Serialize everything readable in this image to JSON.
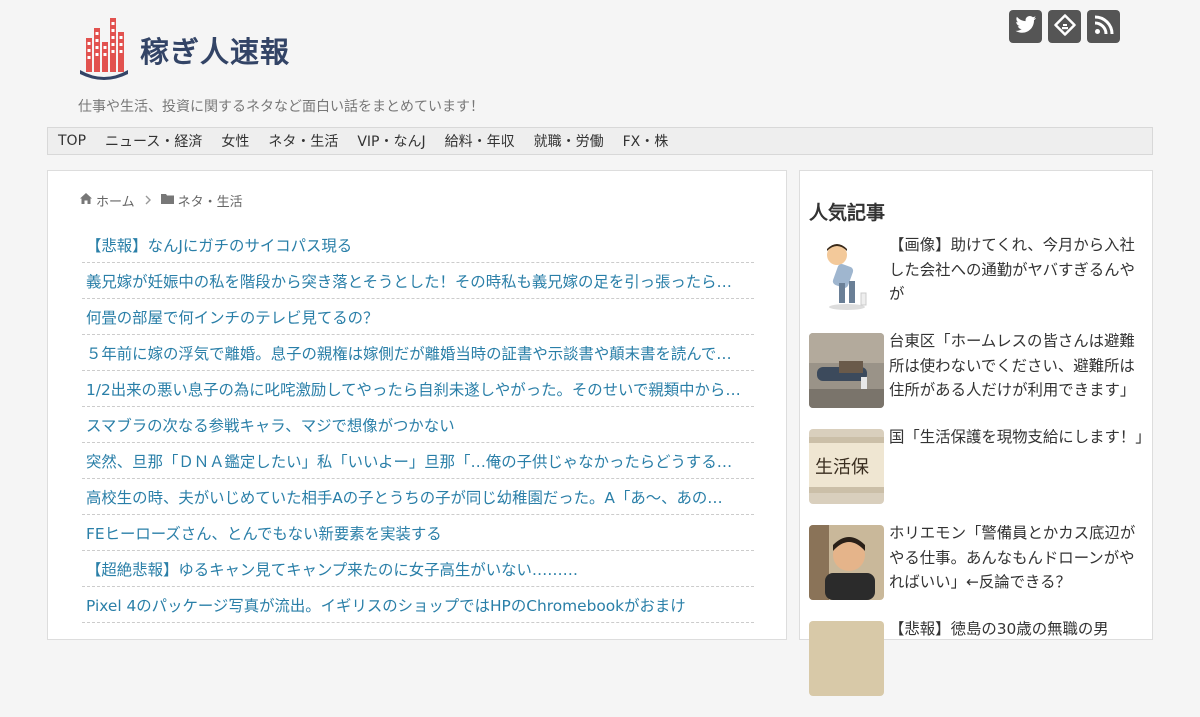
{
  "site": {
    "logo_text": "稼ぎ人速報",
    "tagline": "仕事や生活、投資に関するネタなど面白い話をまとめています！"
  },
  "social": [
    {
      "icon": "twitter-icon"
    },
    {
      "icon": "feedly-icon"
    },
    {
      "icon": "rss-icon"
    }
  ],
  "nav": {
    "items": [
      "TOP",
      "ニュース・経済",
      "女性",
      "ネタ・生活",
      "VIP・なんJ",
      "給料・年収",
      "就職・労働",
      "FX・株"
    ]
  },
  "breadcrumb": {
    "home": "ホーム",
    "category": "ネタ・生活"
  },
  "articles": [
    "【悲報】なんJにガチのサイコパス現る",
    "義兄嫁が妊娠中の私を階段から突き落とそうとした！その時私も義兄嫁の足を引っ張ったら…",
    "何畳の部屋で何インチのテレビ見てるの？",
    "５年前に嫁の浮気で離婚。息子の親権は嫁側だが離婚当時の証書や示談書や顛末書を読んで…",
    "1/2出来の悪い息子の為に叱咤激励してやったら自刹未遂しやがった。そのせいで親類中から…",
    "スマブラの次なる参戦キャラ、マジで想像がつかない",
    "突然、旦那「ＤＮＡ鑑定したい」私「いいよー」旦那「…俺の子供じゃなかったらどうする…",
    "高校生の時、夫がいじめていた相手Aの子とうちの子が同じ幼稚園だった。A「あ～、あの…",
    "FEヒーローズさん、とんでもない新要素を実装する",
    "【超絶悲報】ゆるキャン見てキャンプ来たのに女子高生がいない………",
    "Pixel 4のパッケージ写真が流出。イギリスのショップではHPのChromebookがおまけ"
  ],
  "sidebar": {
    "title": "人気記事",
    "items": [
      {
        "text": "【画像】助けてくれ、今月から入社した会社への通勤がヤバすぎるんやが"
      },
      {
        "text": "台東区「ホームレスの皆さんは避難所は使わないでください、避難所は住所がある人だけが利用できます」"
      },
      {
        "text": "国「生活保護を現物支給にします！」"
      },
      {
        "text": "ホリエモン「警備員とかカス底辺がやる仕事。あんなもんドローンがやればいい」←反論できる？"
      },
      {
        "text": "【悲報】徳島の30歳の無職の男"
      }
    ]
  },
  "colors": {
    "link": "#2a7fa8",
    "logo_text": "#334466",
    "logo_mark": "#e2524f",
    "social_bg": "#555555"
  }
}
